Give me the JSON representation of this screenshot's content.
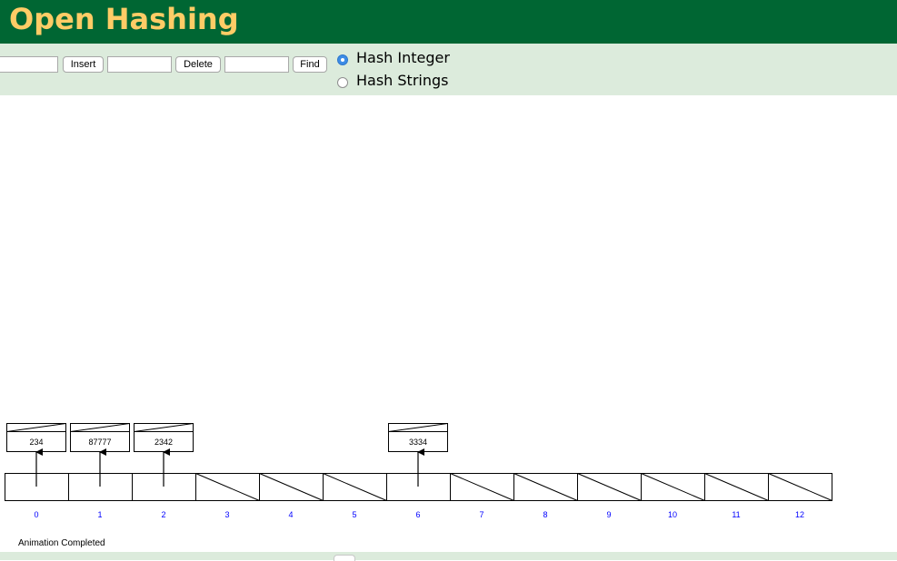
{
  "header": {
    "title": "Open Hashing"
  },
  "toolbar": {
    "insert_value": "",
    "insert_label": "Insert",
    "delete_value": "",
    "delete_label": "Delete",
    "find_value": "",
    "find_label": "Find",
    "options": [
      {
        "label": "Hash Integer",
        "selected": true
      },
      {
        "label": "Hash Strings",
        "selected": false
      }
    ]
  },
  "hash_table": {
    "indices": [
      "0",
      "1",
      "2",
      "3",
      "4",
      "5",
      "6",
      "7",
      "8",
      "9",
      "10",
      "11",
      "12"
    ],
    "chains": [
      {
        "bucket": 0,
        "value": "234"
      },
      {
        "bucket": 1,
        "value": "87777"
      },
      {
        "bucket": 2,
        "value": "2342"
      },
      {
        "bucket": 6,
        "value": "3334"
      }
    ]
  },
  "status": {
    "message": "Animation Completed"
  },
  "colors": {
    "header_bg": "#006633",
    "title": "#ffcc66",
    "controls_bg": "#dcebdc",
    "index_label": "#0000ff",
    "radio_selected": "#3d8ce6"
  }
}
